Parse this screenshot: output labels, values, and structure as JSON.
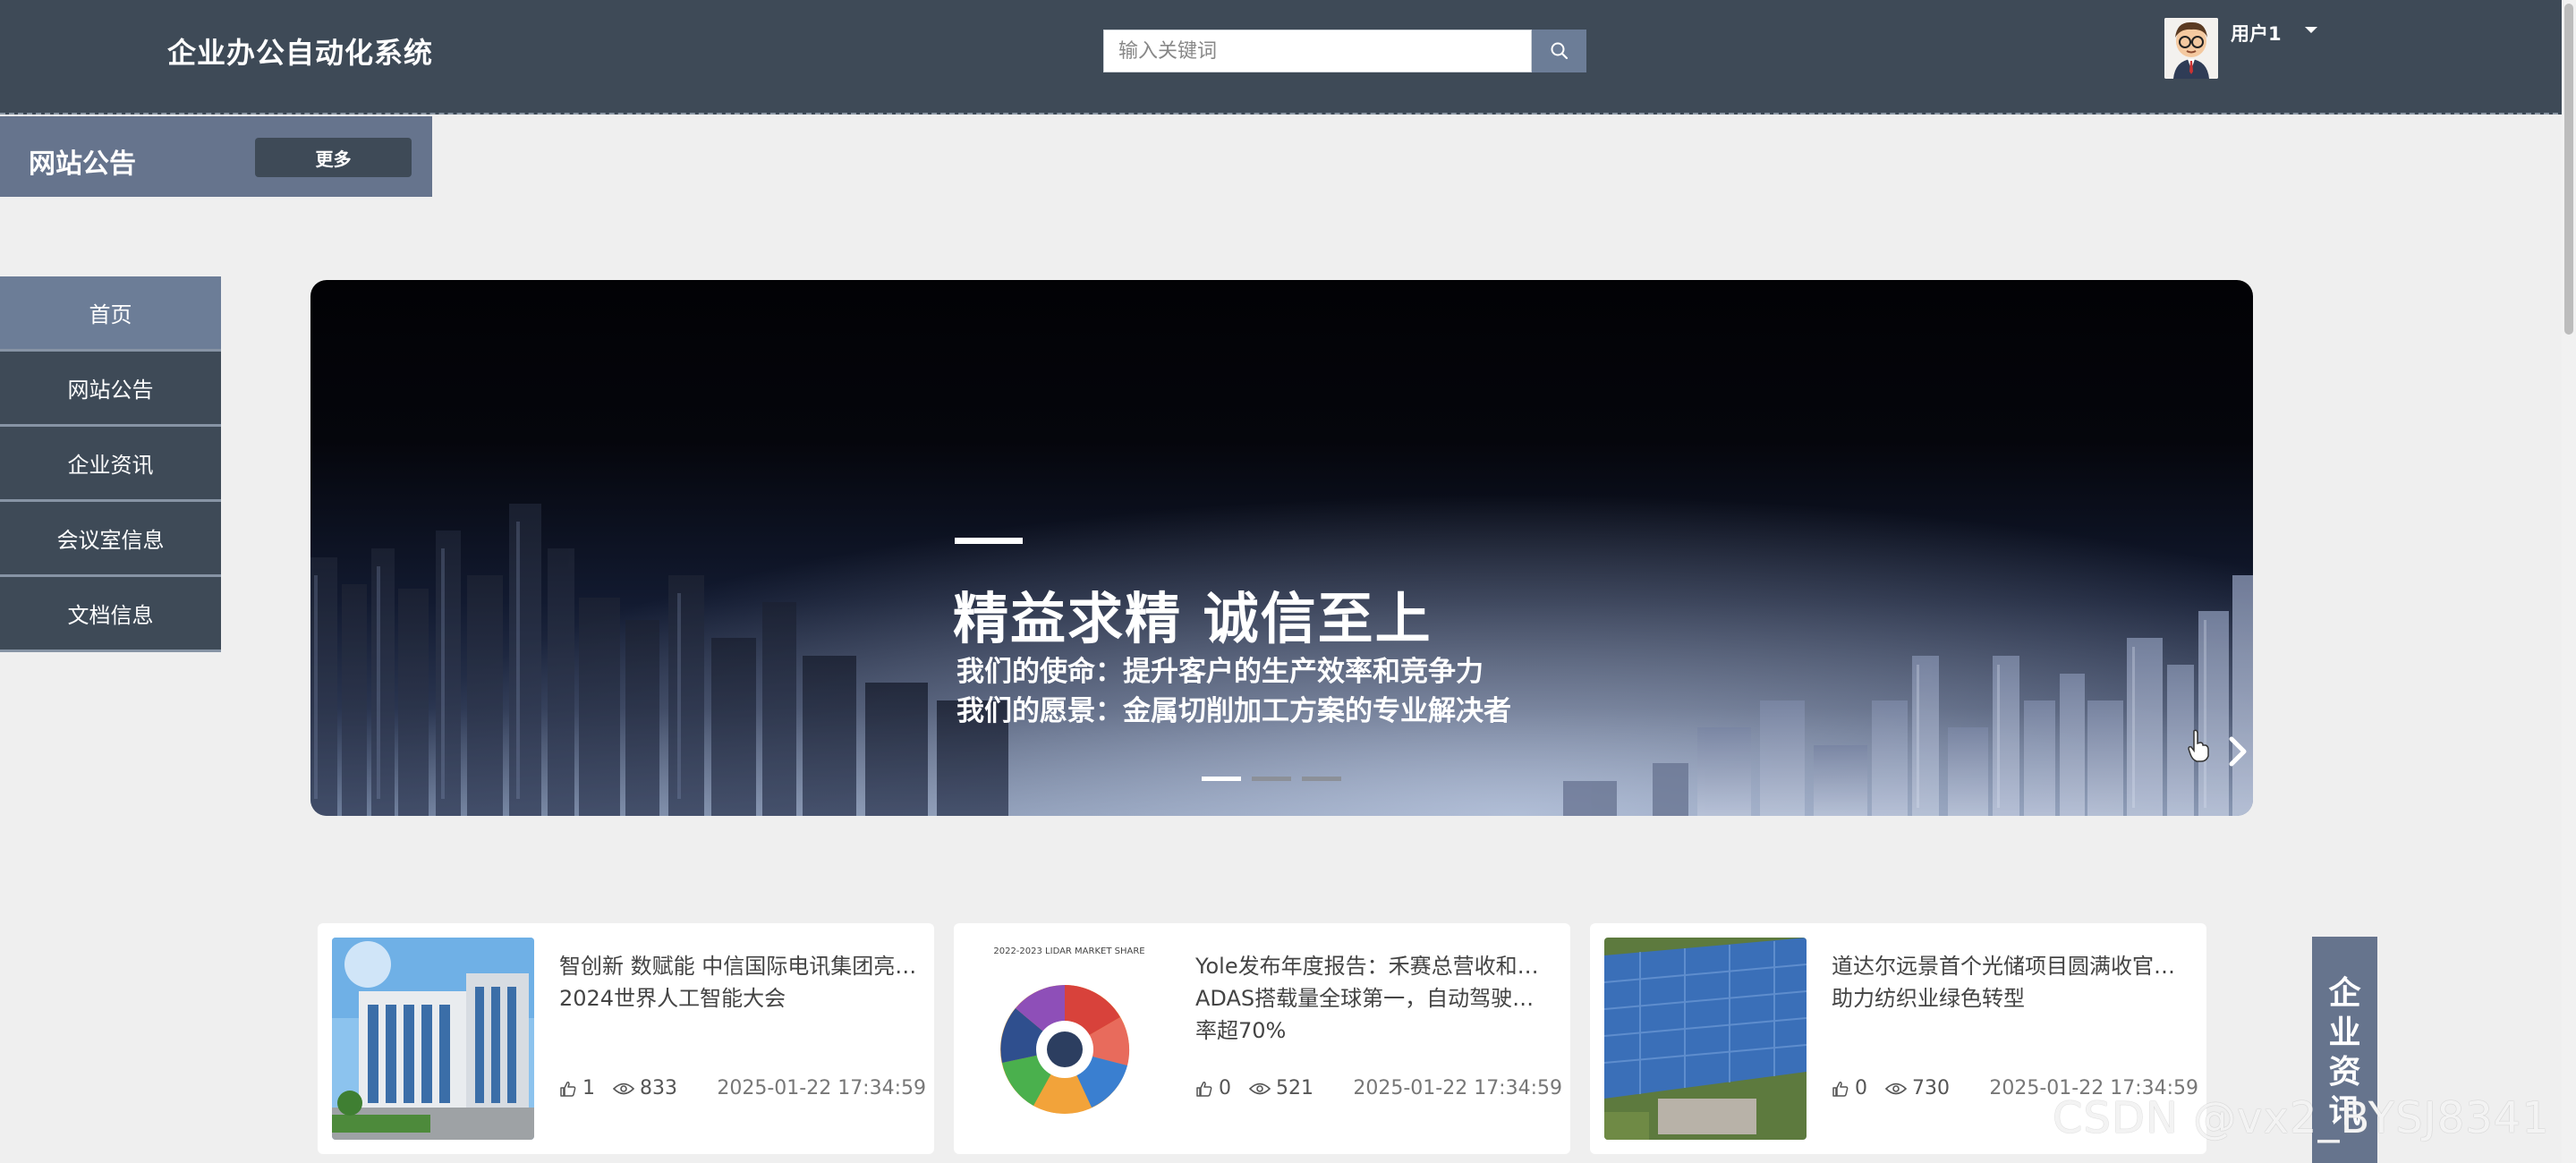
{
  "header": {
    "app_title": "企业办公自动化系统",
    "search": {
      "placeholder": "输入关键词",
      "value": ""
    },
    "user": {
      "name": "用户1"
    }
  },
  "notice_bar": {
    "title": "网站公告",
    "more_label": "更多"
  },
  "nav": {
    "items": [
      {
        "label": "首页",
        "active": true
      },
      {
        "label": "网站公告",
        "active": false
      },
      {
        "label": "企业资讯",
        "active": false
      },
      {
        "label": "会议室信息",
        "active": false
      },
      {
        "label": "文档信息",
        "active": false
      }
    ]
  },
  "banner": {
    "headline": "精益求精 诚信至上",
    "line1": "我们的使命：提升客户的生产效率和竞争力",
    "line2": "我们的愿景：金属切削加工方案的专业解决者",
    "slide_count": 3,
    "active_slide": 1
  },
  "news": [
    {
      "title_line1": "智创新 数赋能 中信国际电讯集团亮…",
      "title_line2": "2024世界人工智能大会",
      "title_line3": "",
      "likes": "1",
      "views": "833",
      "date": "2025-01-22 17:34:59"
    },
    {
      "title_line1": "Yole发布年度报告：禾赛总营收和…",
      "title_line2": "ADAS搭载量全球第一，自动驾驶市占",
      "title_line3": "率超70%",
      "likes": "0",
      "views": "521",
      "date": "2025-01-22 17:34:59"
    },
    {
      "title_line1": "道达尔远景首个光储项目圆满收官…",
      "title_line2": "助力纺织业绿色转型",
      "title_line3": "",
      "likes": "0",
      "views": "730",
      "date": "2025-01-22 17:34:59"
    }
  ],
  "side_tab": {
    "label_chars": [
      "企",
      "业",
      "资",
      "讯"
    ]
  },
  "thumb2": {
    "title": "2022-2023 LIDAR MARKET SHARE"
  },
  "watermark": "CSDN @vx2_BYSJ8341",
  "colors": {
    "header_bg": "#3e4a57",
    "accent": "#66748d",
    "nav_active": "#6c7d97",
    "page_bg": "#efefef"
  }
}
